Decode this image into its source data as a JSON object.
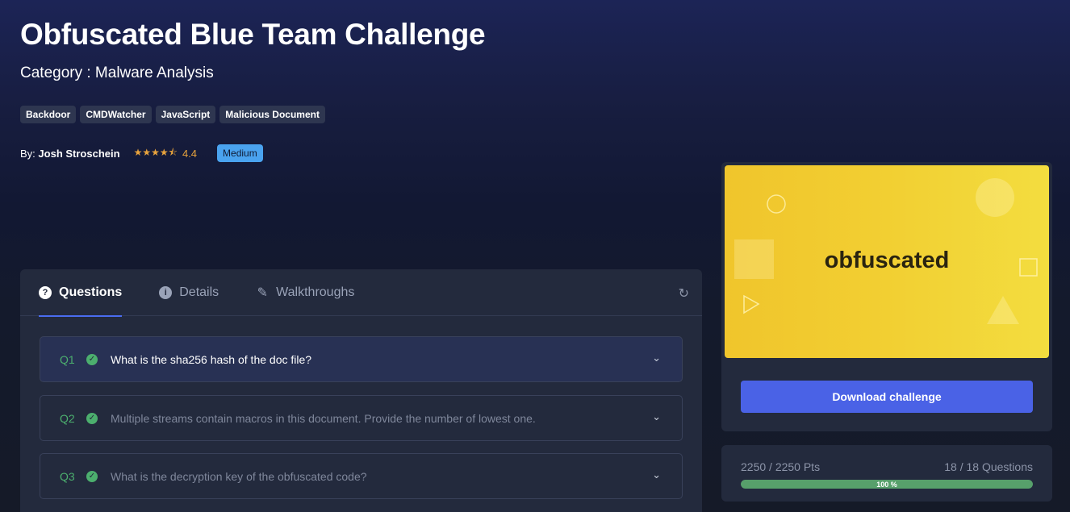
{
  "challenge": {
    "title": "Obfuscated Blue Team Challenge",
    "category": "Category : Malware Analysis",
    "tags": [
      "Backdoor",
      "CMDWatcher",
      "JavaScript",
      "Malicious Document"
    ],
    "by_label": "By:",
    "author": "Josh Stroschein",
    "stars": "★★★★⯪",
    "rating": "4.4",
    "difficulty": "Medium"
  },
  "tabs": [
    {
      "label": "Questions",
      "icon": "question-icon"
    },
    {
      "label": "Details",
      "icon": "info-icon"
    },
    {
      "label": "Walkthroughs",
      "icon": "pen-icon"
    }
  ],
  "refresh_icon": "↻",
  "questions": [
    {
      "num": "Q1",
      "text": "What is the sha256 hash of the doc file?"
    },
    {
      "num": "Q2",
      "text": "Multiple streams contain macros in this document. Provide the number of lowest one."
    },
    {
      "num": "Q3",
      "text": "What is the decryption key of the obfuscated code?"
    }
  ],
  "banner": {
    "word": "obfuscated"
  },
  "download_label": "Download challenge",
  "progress": {
    "points": "2250 / 2250 Pts",
    "questions": "18 / 18 Questions",
    "percent_label": "100 %",
    "fraction": 1.0
  },
  "colors": {
    "accent": "#4a62e6",
    "success": "#4caf6e",
    "warning": "#e8a33d",
    "banner": "#f2cf32"
  }
}
